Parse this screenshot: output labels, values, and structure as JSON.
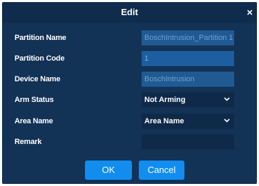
{
  "dialog": {
    "title": "Edit",
    "close_glyph": "×",
    "close_icon": "close-icon"
  },
  "form": {
    "partition_name": {
      "label": "Partition Name",
      "value": "BoschIntrusion_Partition 1"
    },
    "partition_code": {
      "label": "Partition Code",
      "value": "1"
    },
    "device_name": {
      "label": "Device Name",
      "value": "BoschIntrusion"
    },
    "arm_status": {
      "label": "Arm Status",
      "value": "Not Arming",
      "icon": "chevron-down-icon"
    },
    "area_name": {
      "label": "Area Name",
      "value": "Area Name",
      "icon": "chevron-down-icon"
    },
    "remark": {
      "label": "Remark",
      "value": ""
    }
  },
  "buttons": {
    "ok": "OK",
    "cancel": "Cancel"
  },
  "colors": {
    "dialog_bg": "#123256",
    "titlebar_bg": "#0f2c4d",
    "button_bg": "#118df0"
  }
}
